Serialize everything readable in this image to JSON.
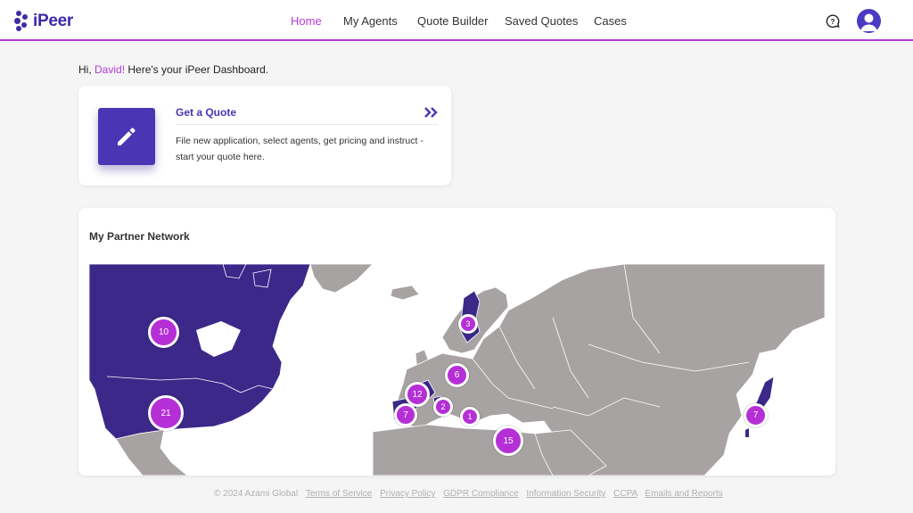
{
  "app": {
    "brand": "iPeer"
  },
  "nav": {
    "items": [
      {
        "label": "Home",
        "active": true
      },
      {
        "label": "My Agents"
      },
      {
        "label": "Quote Builder"
      },
      {
        "label": "Saved Quotes"
      },
      {
        "label": "Cases"
      }
    ]
  },
  "header_icons": [
    "help-chat-icon",
    "user-avatar-icon"
  ],
  "greeting": {
    "prefix": "Hi,",
    "name": "David!",
    "suffix": "Here's your iPeer Dashboard."
  },
  "quote_card": {
    "icon": "pencil-icon",
    "title": "Get a Quote",
    "arrow_icon": "double-chevron-right-icon",
    "description": "File new application, select agents, get pricing and instruct - start your quote here."
  },
  "network": {
    "title": "My Partner Network",
    "clusters": [
      {
        "count": "10"
      },
      {
        "count": "21"
      },
      {
        "count": "3"
      },
      {
        "count": "6"
      },
      {
        "count": "12"
      },
      {
        "count": "2"
      },
      {
        "count": "7"
      },
      {
        "count": "1"
      },
      {
        "count": "15"
      },
      {
        "count": "7"
      }
    ]
  },
  "footer": {
    "copyright": "© 2024 Azami Global",
    "links": [
      "Terms of Service",
      "Privacy Policy",
      "GDPR Compliance",
      "Information Security",
      "CCPA",
      "Emails and Reports"
    ]
  },
  "colors": {
    "brand": "#3e2aa8",
    "accent": "#b23ad6",
    "highlight_country": "#3b2889",
    "land": "#a8a3a3",
    "cluster": "#b52fd6"
  }
}
